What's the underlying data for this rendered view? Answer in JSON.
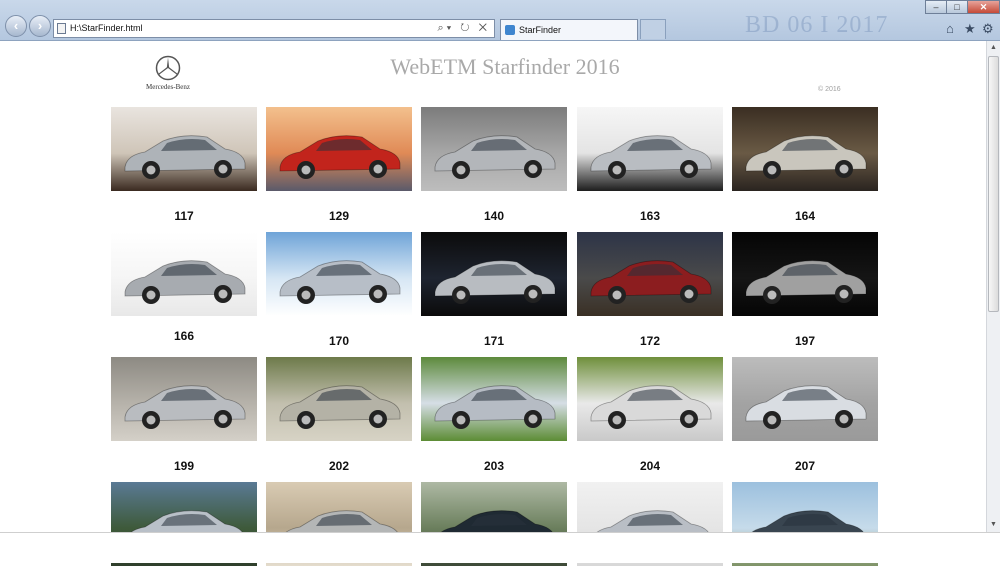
{
  "browser": {
    "address": "H:\\StarFinder.html",
    "tab_title": "StarFinder",
    "watermark": "BD 06 I 2017"
  },
  "page": {
    "brand": "Mercedes-Benz",
    "title": "WebETM Starfinder 2016",
    "copyright": "© 2016"
  },
  "models": [
    {
      "code": "117",
      "bg": [
        "#e9e4df",
        "#cfc5b8",
        "#3a2a20"
      ],
      "car": "#aeb3b8"
    },
    {
      "code": "129",
      "bg": [
        "#f3c08d",
        "#e08a56",
        "#5a5a6a"
      ],
      "car": "#c2241c"
    },
    {
      "code": "140",
      "bg": [
        "#7c7c7c",
        "#a7a7a7",
        "#bdbdbd"
      ],
      "car": "#b3b6ba"
    },
    {
      "code": "163",
      "bg": [
        "#f6f6f6",
        "#e4e4e4",
        "#1d1d1d"
      ],
      "car": "#b9bdc2"
    },
    {
      "code": "164",
      "bg": [
        "#3a2e22",
        "#6a5a45",
        "#2a2420"
      ],
      "car": "#c9c6bd"
    },
    {
      "code": "166",
      "bg": [
        "#ffffff",
        "#f5f5f5",
        "#e8e8e8"
      ],
      "car": "#a7abb0"
    },
    {
      "code": "170",
      "bg": [
        "#6fa4d8",
        "#d6e6f4",
        "#ffffff"
      ],
      "car": "#b7bec7"
    },
    {
      "code": "171",
      "bg": [
        "#0b0b0b",
        "#1e2430",
        "#0b0b0b"
      ],
      "car": "#b8bcc1"
    },
    {
      "code": "172",
      "bg": [
        "#2d3447",
        "#4a4a4a",
        "#3a3025"
      ],
      "car": "#8c1d1f"
    },
    {
      "code": "197",
      "bg": [
        "#050505",
        "#151515",
        "#050505"
      ],
      "car": "#a0a0a0"
    },
    {
      "code": "199",
      "bg": [
        "#8d8a83",
        "#b6b2aa",
        "#d4d0c8"
      ],
      "car": "#b9bcc0"
    },
    {
      "code": "202",
      "bg": [
        "#6d7a4a",
        "#c2bfae",
        "#d7d3c5"
      ],
      "car": "#b4b2a6"
    },
    {
      "code": "203",
      "bg": [
        "#5d8a3c",
        "#d6dee6",
        "#5c8c35"
      ],
      "car": "#b6bcc4"
    },
    {
      "code": "204",
      "bg": [
        "#6f8f3b",
        "#e9e9e9",
        "#c9c9c9"
      ],
      "car": "#d9d9d9"
    },
    {
      "code": "207",
      "bg": [
        "#bcbcbc",
        "#a3a3a3",
        "#9a9a9a"
      ],
      "car": "#d9dde2"
    },
    {
      "code": "",
      "bg": [
        "#5a7a95",
        "#3e5a3a",
        "#2f3f2c"
      ],
      "car": "#b9c0c8"
    },
    {
      "code": "",
      "bg": [
        "#d9cbb3",
        "#b6a78d",
        "#e4dccd"
      ],
      "car": "#b4b6b6"
    },
    {
      "code": "",
      "bg": [
        "#aeb9a4",
        "#6b7f5d",
        "#3d4a38"
      ],
      "car": "#1f2a33"
    },
    {
      "code": "",
      "bg": [
        "#f1f1f1",
        "#e5e5e5",
        "#d8d8d8"
      ],
      "car": "#b9bec5"
    },
    {
      "code": "",
      "bg": [
        "#9cc0de",
        "#c6dbea",
        "#7f9366"
      ],
      "car": "#394550"
    }
  ]
}
